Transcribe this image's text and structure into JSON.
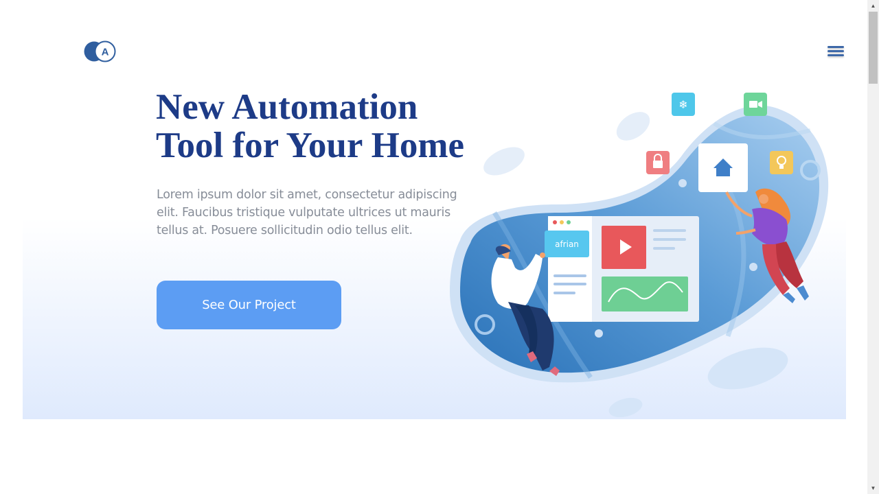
{
  "header": {
    "logo_letter": "A",
    "menu_icon": "hamburger-menu-icon"
  },
  "hero": {
    "title_line1": "New Automation",
    "title_line2": "Tool for Your Home",
    "description": "Lorem ipsum dolor sit amet, consectetur adipiscing elit. Faucibus tristique vulputate ultrices ut mauris tellus at. Posuere sollicitudin odio tellus elit.",
    "cta_label": "See Our Project"
  },
  "illustration": {
    "card_label": "afrian",
    "icons": [
      "snowflake-icon",
      "video-camera-icon",
      "lock-icon",
      "home-icon",
      "lightbulb-icon",
      "play-icon"
    ]
  },
  "colors": {
    "title": "#1d3b87",
    "cta": "#5c9df3",
    "blob": "#4f94d2",
    "play_tile": "#e8585b",
    "chart_tile": "#6ecf94"
  },
  "scrollbar": {
    "up_arrow": "▲",
    "down_arrow": "▼"
  }
}
